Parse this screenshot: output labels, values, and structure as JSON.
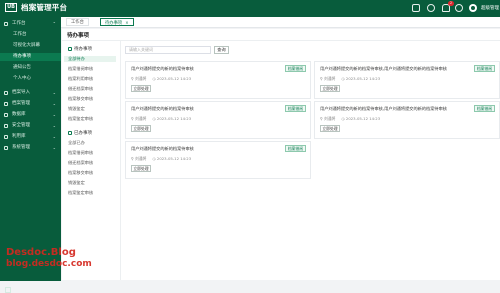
{
  "header": {
    "logo_mark": "UB",
    "app_title": "档案管理平台",
    "icons": [
      "grid-icon",
      "message-icon",
      "bell-icon",
      "settings-icon"
    ],
    "notification_count": "2",
    "username": "超级管理"
  },
  "sidebar": {
    "items": [
      {
        "label": "工作台",
        "icon": "desktop-icon",
        "chevron": "⌃"
      },
      {
        "label": "工作台"
      },
      {
        "label": "可视化大屏幕"
      },
      {
        "label": "待办事项"
      },
      {
        "label": "通知公告"
      },
      {
        "label": "个人中心"
      },
      {
        "label": "档案导入",
        "icon": "import-icon",
        "chevron": "⌄"
      },
      {
        "label": "档案管理",
        "icon": "archive-icon",
        "chevron": "⌄"
      },
      {
        "label": "数据库",
        "icon": "database-icon",
        "chevron": "⌄"
      },
      {
        "label": "安全管理",
        "icon": "shield-icon",
        "chevron": "⌄"
      },
      {
        "label": "利用库",
        "icon": "book-icon",
        "chevron": "⌄"
      },
      {
        "label": "系统管理",
        "icon": "gear-icon",
        "chevron": "⌄"
      }
    ]
  },
  "tabs": [
    {
      "label": "工作台"
    },
    {
      "label": "待办事项",
      "close": "×"
    }
  ],
  "panel": {
    "title": "待办事项",
    "todo_group": "待办事项",
    "todo_items": [
      "全部待办",
      "档案借阅审核",
      "档案利用审核",
      "借还档案审核",
      "档案移交审核",
      "销毁鉴定",
      "档案鉴定审核"
    ],
    "done_group": "已办事项",
    "done_items": [
      "全部已办",
      "档案借阅审核",
      "借还档案审核",
      "档案移交审核",
      "销毁鉴定",
      "档案鉴定审核"
    ],
    "search_placeholder": "请输入关键词",
    "search_button": "查询"
  },
  "cards": [
    {
      "title": "用户刘通将提交的新的档案待审核",
      "tag": "档案借阅",
      "user": "刘通将",
      "time": "2023-05-12 14:23",
      "action": "立即处理"
    },
    {
      "title": "用户刘通将提交的新的档案待审核,用户刘通将提交的新的档案待审核",
      "tag": "档案借阅",
      "user": "刘通将",
      "time": "2023-05-12 14:23",
      "action": "立即处理"
    },
    {
      "title": "用户刘通将提交的新的档案待审核",
      "tag": "档案借阅",
      "user": "刘通将",
      "time": "2023-05-12 14:23",
      "action": "立即处理"
    },
    {
      "title": "用户刘通将提交的新的档案待审核,用户刘通将提交的新的档案待审核",
      "tag": "档案借阅",
      "user": "刘通将",
      "time": "2023-05-12 14:23",
      "action": "立即处理"
    },
    {
      "title": "用户刘通将提交的新的档案待审核",
      "tag": "档案借阅",
      "user": "刘通将",
      "time": "2023-05-12 14:23",
      "action": "立即处理"
    }
  ],
  "watermark": {
    "line1": "Desdoc.Blog",
    "line2": "blog.desdoc.com"
  },
  "colors": {
    "brand": "#085c3c",
    "accent": "#0b7a50",
    "watermark": "#d4281f"
  }
}
